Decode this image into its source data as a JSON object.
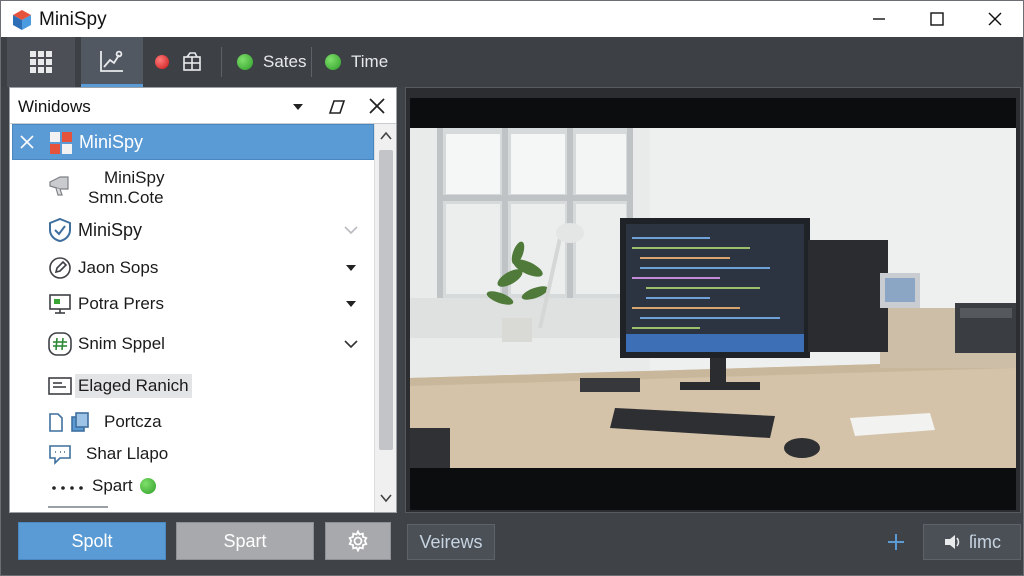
{
  "window": {
    "title": "MiniSpy"
  },
  "toolbar": {
    "status": [
      {
        "label": "Sates",
        "color": "#3aa535"
      },
      {
        "label": "Time",
        "color": "#3aa535"
      }
    ],
    "record_color": "#d42020"
  },
  "panel": {
    "title": "Winidows",
    "items": [
      {
        "label": "MiniSpy",
        "icon": "app-grid-icon",
        "selected": true
      },
      {
        "label": "MiniSpy",
        "label2": "Smn.Cote",
        "icon": "megaphone-icon"
      },
      {
        "label": "MiniSpy",
        "icon": "shield-icon",
        "chevron": "chevron-down-light"
      },
      {
        "label": "Jaon Sops",
        "icon": "edit-circle-icon",
        "chevron": "triangle-down"
      },
      {
        "label": "Potra Prers",
        "icon": "monitor-icon",
        "chevron": "triangle-down"
      },
      {
        "label": "Snim Sppel",
        "icon": "hash-circle-icon",
        "chevron": "chevron-down"
      },
      {
        "label": "Elaged Ranich",
        "icon": "image-icon"
      },
      {
        "label": "Portcza",
        "icon": "files-icon"
      },
      {
        "label": "Shar Llapo",
        "icon": "chat-icon"
      },
      {
        "label": "Spart",
        "icon": "dots-icon",
        "status_color": "#3aa535"
      }
    ]
  },
  "buttons": {
    "start": "Spolt",
    "stop": "Spart",
    "views": "Veirews",
    "time": "ſimc"
  },
  "colors": {
    "accent": "#5b9bd5",
    "toolbar_bg": "#3d4045",
    "panel_bg": "#ffffff"
  }
}
